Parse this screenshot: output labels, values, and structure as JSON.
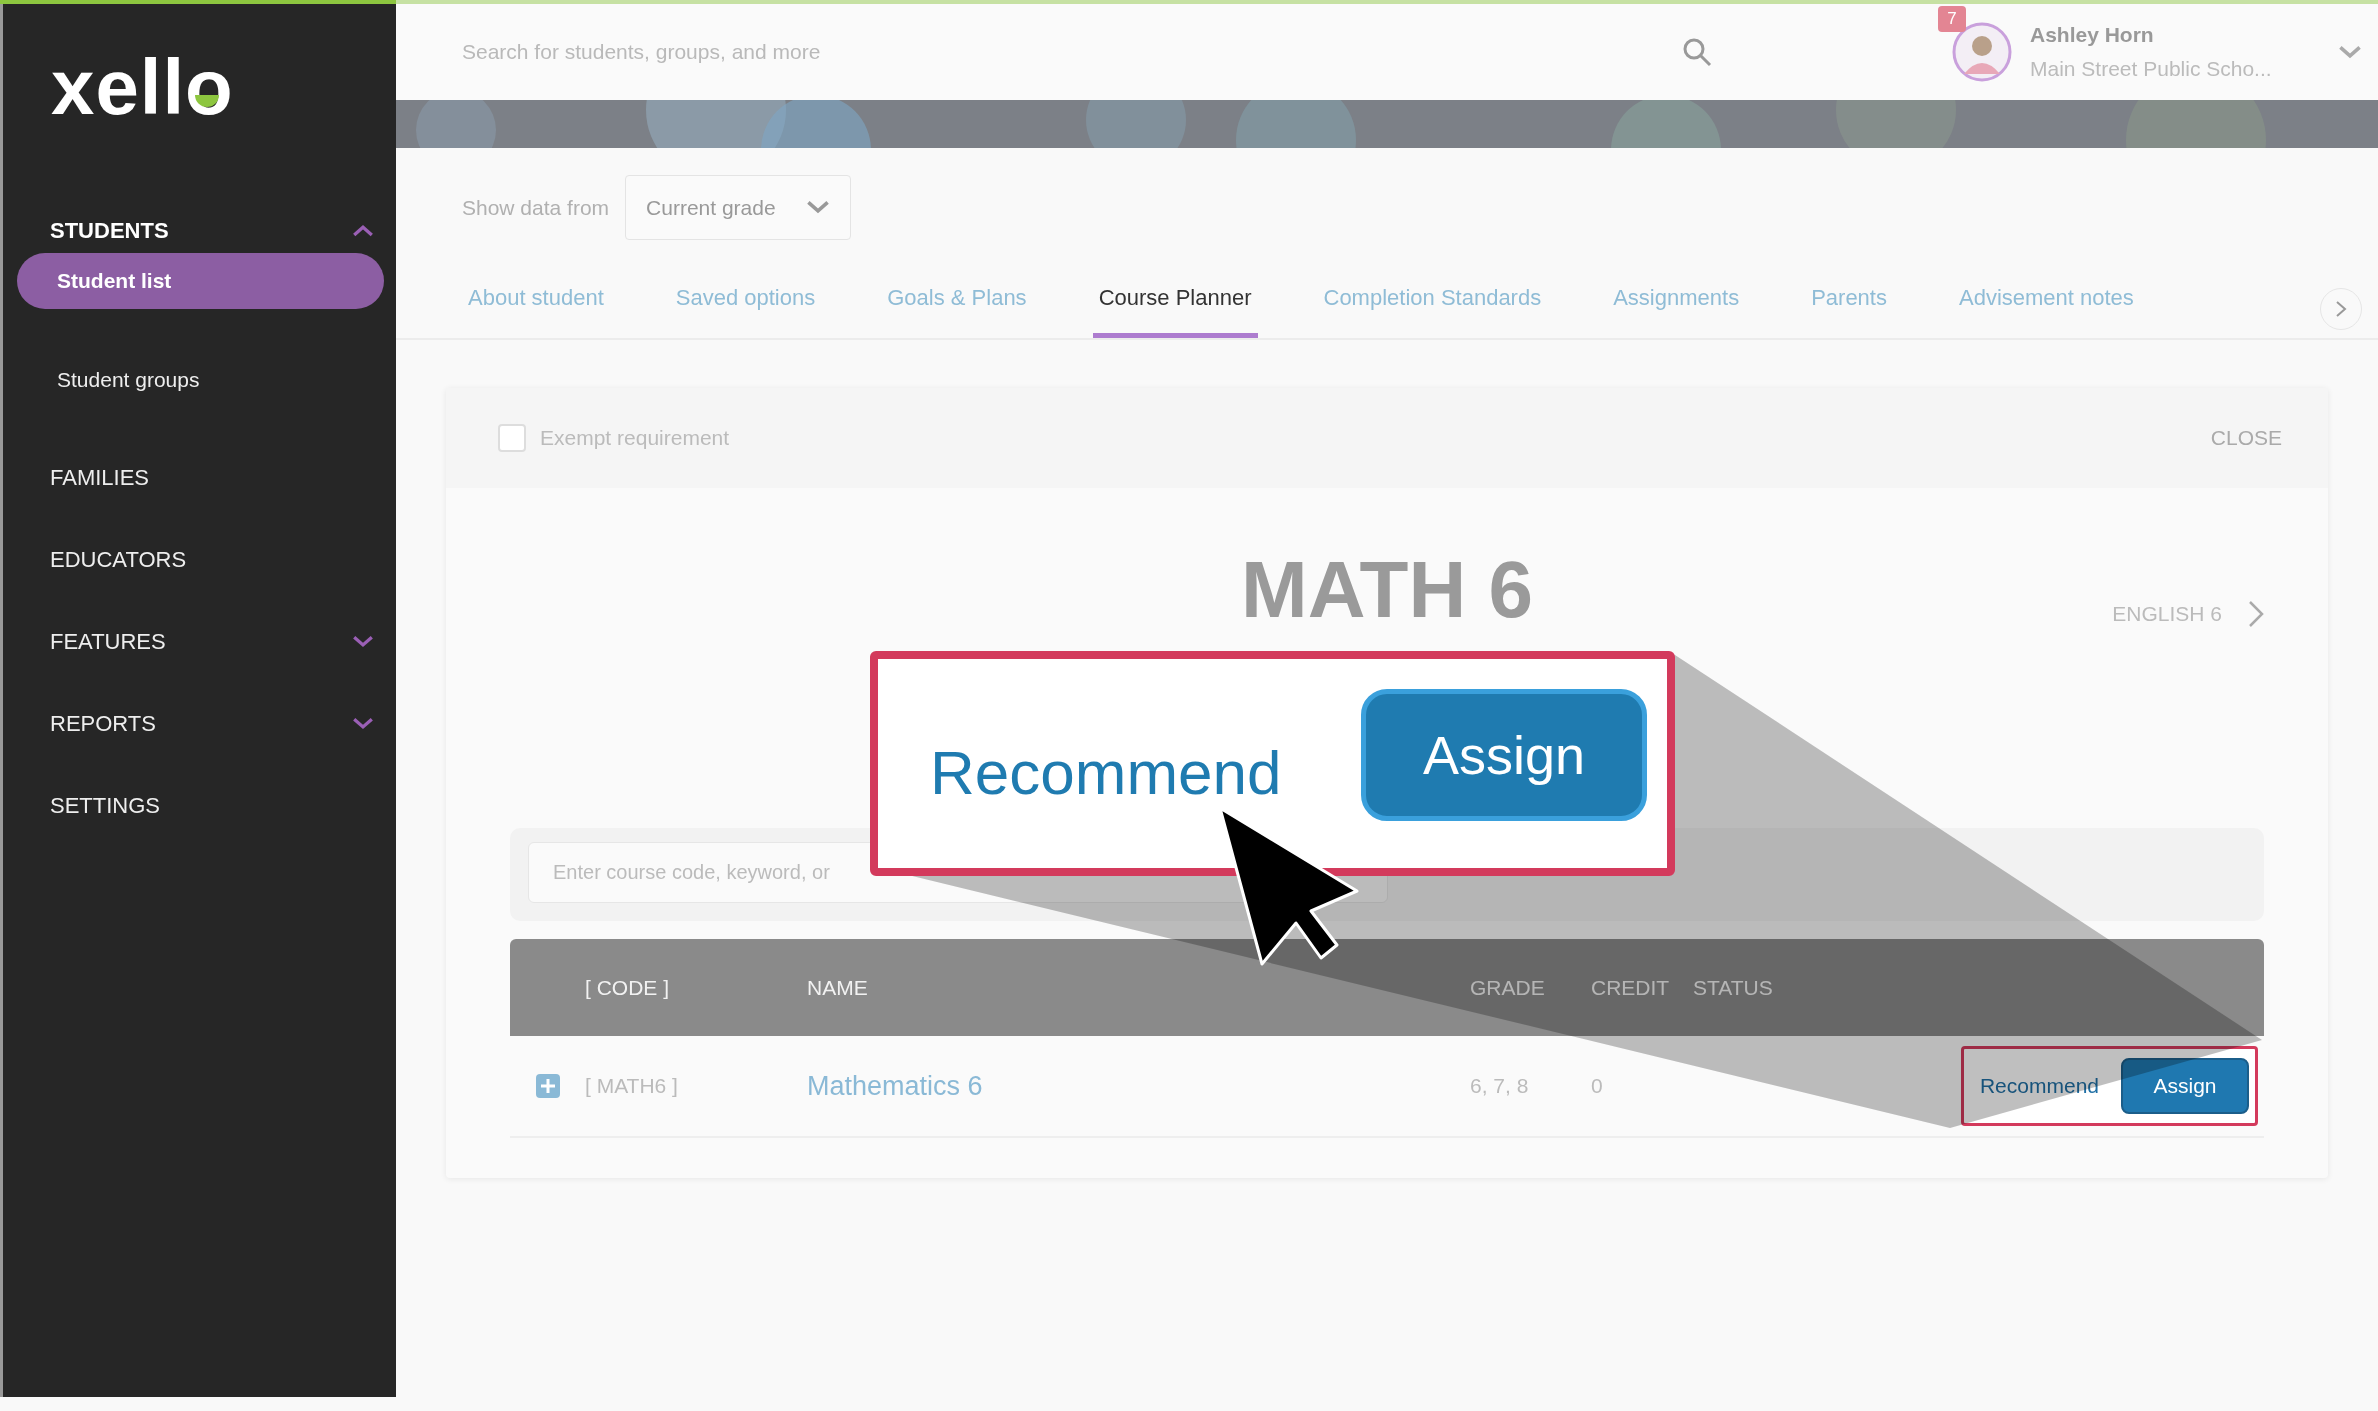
{
  "sidebar": {
    "logo": "xello",
    "items": [
      {
        "label": "STUDENTS",
        "kind": "section",
        "expanded": true,
        "children": [
          {
            "label": "Student list",
            "selected": true
          },
          {
            "label": "Student groups",
            "selected": false
          }
        ]
      },
      {
        "label": "FAMILIES",
        "kind": "link"
      },
      {
        "label": "EDUCATORS",
        "kind": "link"
      },
      {
        "label": "FEATURES",
        "kind": "section",
        "expanded": false
      },
      {
        "label": "REPORTS",
        "kind": "section",
        "expanded": false
      },
      {
        "label": "SETTINGS",
        "kind": "link"
      }
    ]
  },
  "top_bar": {
    "search": {
      "placeholder": "Search for students, groups, and more"
    },
    "user": {
      "notifications": "7",
      "name": "Ashley Horn",
      "school": "Main Street Public Scho..."
    }
  },
  "filter": {
    "label": "Show data from",
    "value": "Current grade"
  },
  "tabs": [
    {
      "label": "About student",
      "selected": false
    },
    {
      "label": "Saved options",
      "selected": false
    },
    {
      "label": "Goals & Plans",
      "selected": false
    },
    {
      "label": "Course Planner",
      "selected": true
    },
    {
      "label": "Completion Standards",
      "selected": false
    },
    {
      "label": "Assignments",
      "selected": false
    },
    {
      "label": "Parents",
      "selected": false
    },
    {
      "label": "Advisement notes",
      "selected": false
    }
  ],
  "course_panel": {
    "exempt": {
      "label": "Exempt requirement",
      "checked": false
    },
    "close": "CLOSE",
    "title": "MATH 6",
    "next": "ENGLISH 6",
    "search": {
      "placeholder": "Enter course code, keyword, or"
    },
    "columns": [
      "[ CODE ]",
      "NAME",
      "GRADE",
      "CREDIT",
      "STATUS"
    ],
    "rows": [
      {
        "code": "[ MATH6 ]",
        "name": "Mathematics 6",
        "grade": "6, 7, 8",
        "credit": "0",
        "recommend": "Recommend",
        "assign": "Assign"
      }
    ]
  },
  "callout": {
    "recommend": "Recommend",
    "assign": "Assign"
  }
}
